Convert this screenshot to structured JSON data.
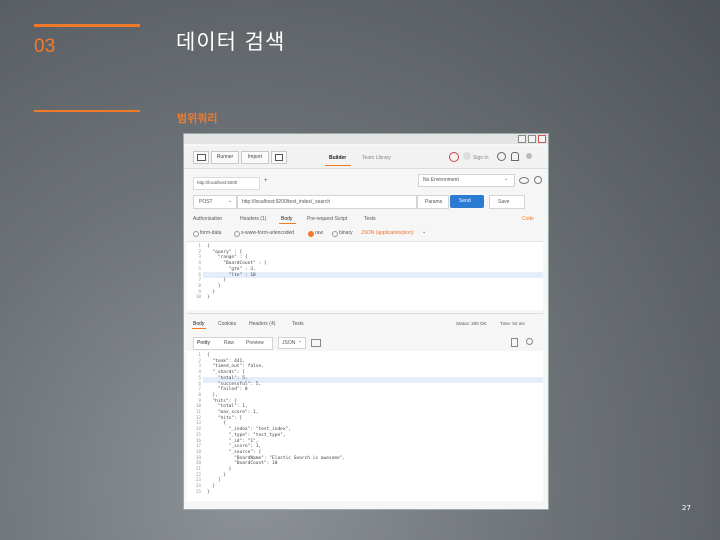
{
  "slide": {
    "section_number": "03",
    "title": "데이터 검색",
    "subtitle": "범위쿼리",
    "page_number": "27"
  },
  "app": {
    "toolbar": {
      "runner": "Runner",
      "import": "Import",
      "builder": "Builder",
      "team_library": "Team Library",
      "sign_in": "Sign In"
    },
    "tab": {
      "label": "http://localhost:9200"
    },
    "environment": "No Environment",
    "request": {
      "method": "POST",
      "url": "http://localhost:9200/test_index/_search",
      "params": "Params",
      "send": "Send",
      "save": "Save"
    },
    "req_tabs": [
      "Authorization",
      "Headers (1)",
      "Body",
      "Pre-request Script",
      "Tests"
    ],
    "code_link": "Code",
    "body_modes": [
      "form-data",
      "x-www-form-urlencoded",
      "raw",
      "binary"
    ],
    "content_type": "JSON (application/json)",
    "request_lines": [
      "1",
      "2",
      "3",
      "4",
      "5",
      "6",
      "7",
      "8",
      "9",
      "10"
    ],
    "request_code": "{\n  \"query\" : {\n    \"range\" : {\n      \"BoardCount\" : {\n        \"gte\" : 3,\n        \"lte\" : 10\n      }\n    }\n  }\n}",
    "resp_tabs": [
      "Body",
      "Cookies",
      "Headers (4)",
      "Tests"
    ],
    "status": "Status: 200 OK",
    "time": "Time: 54 ms",
    "view_modes": [
      "Pretty",
      "Raw",
      "Preview"
    ],
    "format": "JSON",
    "response_lines": [
      "1",
      "2",
      "3",
      "4",
      "5",
      "6",
      "7",
      "8",
      "9",
      "10",
      "11",
      "12",
      "13",
      "14",
      "15",
      "16",
      "17",
      "18",
      "19",
      "20",
      "21",
      "22",
      "23",
      "24",
      "25"
    ],
    "response_code": "{\n  \"took\": 441,\n  \"timed_out\": false,\n  \"_shards\": {\n    \"total\": 5,\n    \"successful\": 5,\n    \"failed\": 0\n  },\n  \"hits\": {\n    \"total\": 1,\n    \"max_score\": 1,\n    \"hits\": [\n      {\n        \"_index\": \"test_index\",\n        \"_type\": \"test_type\",\n        \"_id\": \"1\",\n        \"_score\": 1,\n        \"_source\": {\n          \"BoardName\": \"Elastic Search is awesome\",\n          \"BoardCount\": 10\n        }\n      }\n    ]\n  }\n}"
  }
}
